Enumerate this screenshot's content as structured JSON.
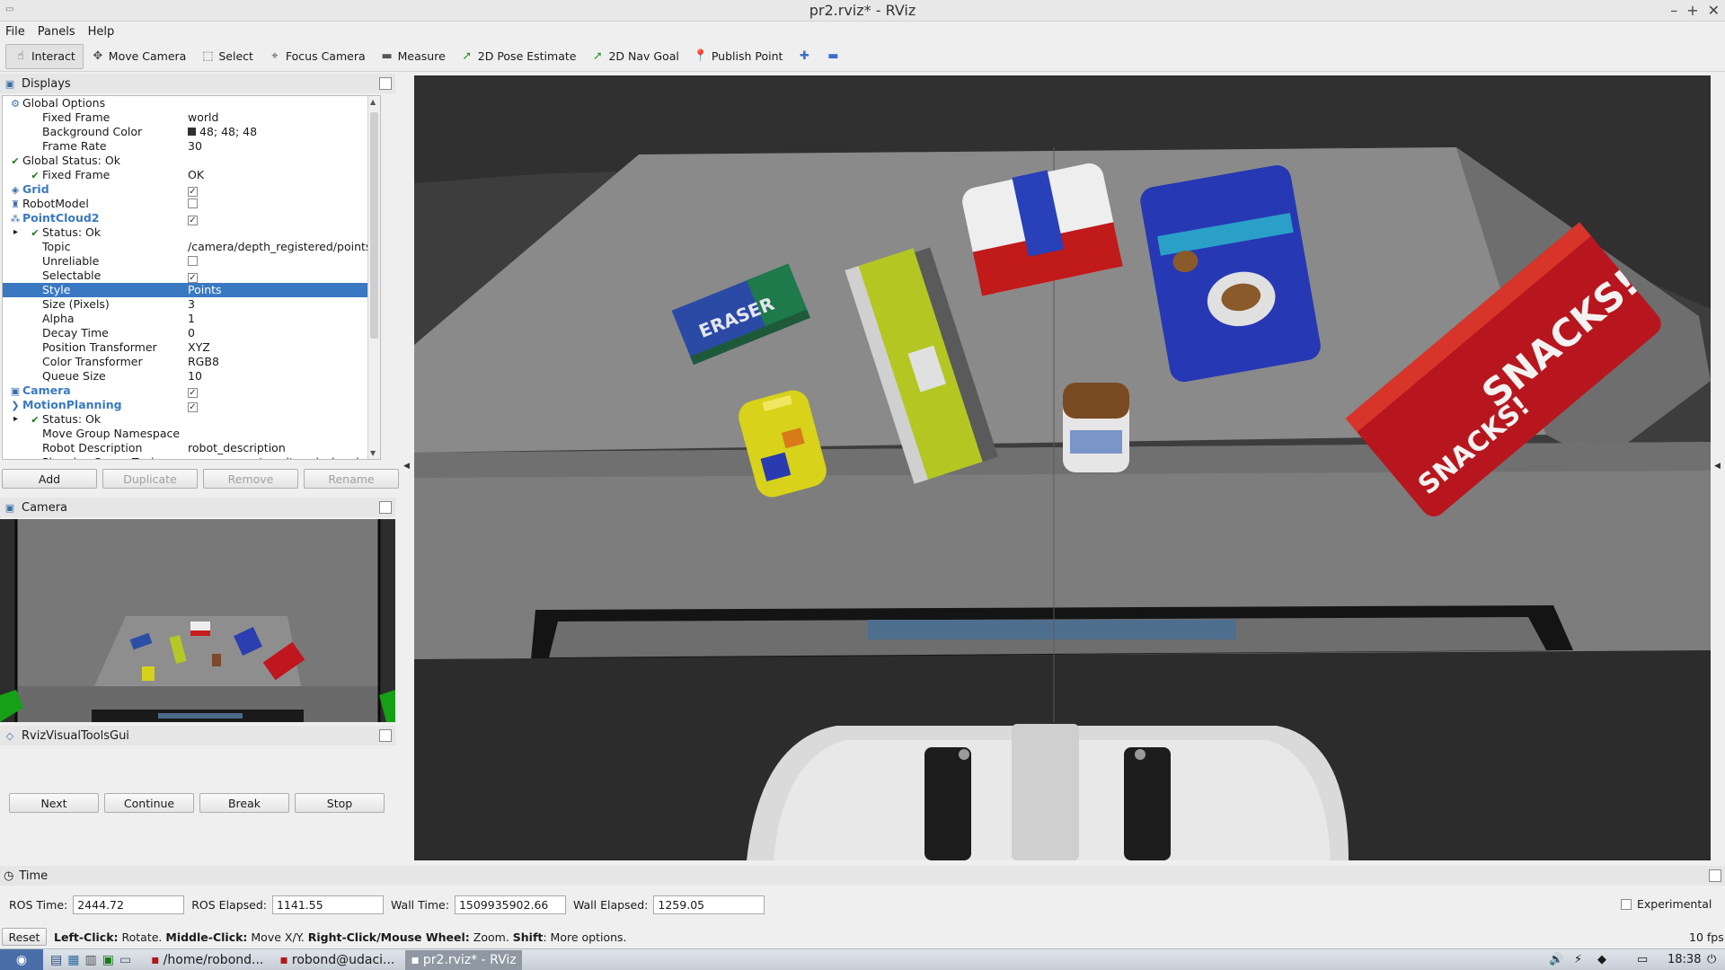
{
  "window": {
    "title": "pr2.rviz* - RViz",
    "controls": [
      "–",
      "+",
      "✕"
    ]
  },
  "menu": [
    "File",
    "Panels",
    "Help"
  ],
  "toolbar": [
    {
      "label": "Interact",
      "icon": "hand-icon",
      "glyph": "☝",
      "active": true
    },
    {
      "label": "Move Camera",
      "icon": "move-camera-icon",
      "glyph": "✥"
    },
    {
      "label": "Select",
      "icon": "select-icon",
      "glyph": "⬚"
    },
    {
      "label": "Focus Camera",
      "icon": "focus-camera-icon",
      "glyph": "⌖"
    },
    {
      "label": "Measure",
      "icon": "ruler-icon",
      "glyph": "▬"
    },
    {
      "label": "2D Pose Estimate",
      "icon": "pose-estimate-icon",
      "glyph": "➚"
    },
    {
      "label": "2D Nav Goal",
      "icon": "nav-goal-icon",
      "glyph": "➚"
    },
    {
      "label": "Publish Point",
      "icon": "map-pin-icon",
      "glyph": "📍"
    },
    {
      "label": "",
      "icon": "plus-icon",
      "glyph": "✚"
    },
    {
      "label": "",
      "icon": "minus-icon",
      "glyph": "▬"
    }
  ],
  "displays": {
    "title": "Displays",
    "rows": [
      {
        "name": "Global Options",
        "indent": 0,
        "icon": "gear-icon",
        "glyph": "⚙",
        "value": ""
      },
      {
        "name": "Fixed Frame",
        "indent": 1,
        "value": "world"
      },
      {
        "name": "Background Color",
        "indent": 1,
        "value": "48; 48; 48",
        "swatch": "#303030"
      },
      {
        "name": "Frame Rate",
        "indent": 1,
        "value": "30"
      },
      {
        "name": "Global Status: Ok",
        "indent": 0,
        "icon": "check-icon",
        "glyph": "✔",
        "value": ""
      },
      {
        "name": "Fixed Frame",
        "indent": 1,
        "icon": "check-icon",
        "glyph": "✔",
        "value": "OK"
      },
      {
        "name": "Grid",
        "indent": 0,
        "icon": "grid-icon",
        "glyph": "◈",
        "bold": true,
        "check": true
      },
      {
        "name": "RobotModel",
        "indent": 0,
        "icon": "robot-icon",
        "glyph": "♜",
        "check": false
      },
      {
        "name": "PointCloud2",
        "indent": 0,
        "icon": "pointcloud-icon",
        "glyph": "⁂",
        "bold": true,
        "check": true
      },
      {
        "name": "Status: Ok",
        "indent": 1,
        "icon": "check-icon",
        "glyph": "✔",
        "expand": "▸",
        "value": ""
      },
      {
        "name": "Topic",
        "indent": 1,
        "value": "/camera/depth_registered/points"
      },
      {
        "name": "Unreliable",
        "indent": 1,
        "check": false
      },
      {
        "name": "Selectable",
        "indent": 1,
        "check": true
      },
      {
        "name": "Style",
        "indent": 1,
        "value": "Points",
        "selected": true
      },
      {
        "name": "Size (Pixels)",
        "indent": 1,
        "value": "3"
      },
      {
        "name": "Alpha",
        "indent": 1,
        "value": "1"
      },
      {
        "name": "Decay Time",
        "indent": 1,
        "value": "0"
      },
      {
        "name": "Position Transformer",
        "indent": 1,
        "value": "XYZ"
      },
      {
        "name": "Color Transformer",
        "indent": 1,
        "value": "RGB8"
      },
      {
        "name": "Queue Size",
        "indent": 1,
        "value": "10"
      },
      {
        "name": "Camera",
        "indent": 0,
        "icon": "camera-icon",
        "glyph": "▣",
        "bold": true,
        "check": true
      },
      {
        "name": "MotionPlanning",
        "indent": 0,
        "icon": "motion-planning-icon",
        "glyph": "❯",
        "bold": true,
        "check": true
      },
      {
        "name": "Status: Ok",
        "indent": 1,
        "icon": "check-icon",
        "glyph": "✔",
        "expand": "▸",
        "value": ""
      },
      {
        "name": "Move Group Namespace",
        "indent": 1,
        "value": ""
      },
      {
        "name": "Robot Description",
        "indent": 1,
        "value": "robot_description"
      },
      {
        "name": "Planning Scene Topic",
        "indent": 1,
        "value": "move_group/monitored_planning_..."
      }
    ],
    "buttons": [
      {
        "label": "Add",
        "enabled": true
      },
      {
        "label": "Duplicate",
        "enabled": false
      },
      {
        "label": "Remove",
        "enabled": false
      },
      {
        "label": "Rename",
        "enabled": false
      }
    ]
  },
  "camera_panel": {
    "title": "Camera"
  },
  "visual_tools": {
    "title": "RvizVisualToolsGui",
    "buttons": [
      "Next",
      "Continue",
      "Break",
      "Stop"
    ]
  },
  "scene": {
    "background": "#303030",
    "labels": {
      "eraser": "ERASER",
      "snacks": "SNACKS!"
    }
  },
  "time_panel": {
    "title": "Time",
    "ros_time_label": "ROS Time:",
    "ros_time": "2444.72",
    "ros_elapsed_label": "ROS Elapsed:",
    "ros_elapsed": "1141.55",
    "wall_time_label": "Wall Time:",
    "wall_time": "1509935902.66",
    "wall_elapsed_label": "Wall Elapsed:",
    "wall_elapsed": "1259.05",
    "experimental_label": "Experimental"
  },
  "status_bar": {
    "reset_label": "Reset",
    "hint_parts": [
      {
        "t": "Left-Click:",
        "b": true
      },
      {
        "t": " Rotate. ",
        "b": false
      },
      {
        "t": "Middle-Click:",
        "b": true
      },
      {
        "t": " Move X/Y. ",
        "b": false
      },
      {
        "t": "Right-Click/Mouse Wheel:",
        "b": true
      },
      {
        "t": " Zoom. ",
        "b": false
      },
      {
        "t": "Shift",
        "b": true
      },
      {
        "t": ": More options.",
        "b": false
      }
    ],
    "fps": "10 fps"
  },
  "taskbar": {
    "tasks": [
      {
        "label": "/home/robond...",
        "icon": "terminal-icon"
      },
      {
        "label": "robond@udaci...",
        "icon": "terminal-icon"
      },
      {
        "label": "pr2.rviz* - RViz",
        "icon": "rviz-icon",
        "active": true
      }
    ],
    "clock": "18:38"
  }
}
